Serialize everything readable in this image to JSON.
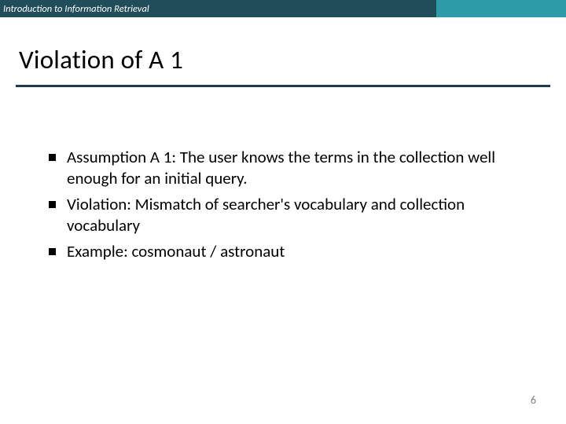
{
  "header": {
    "breadcrumb": "Introduction to Information Retrieval"
  },
  "slide": {
    "title": "Violation of A 1",
    "bullets": [
      "Assumption A 1: The user knows the terms in the collection well enough for an initial query.",
      "Violation: Mismatch of searcher's vocabulary and collection vocabulary",
      "Example: cosmonaut / astronaut"
    ],
    "page_number": "6"
  }
}
